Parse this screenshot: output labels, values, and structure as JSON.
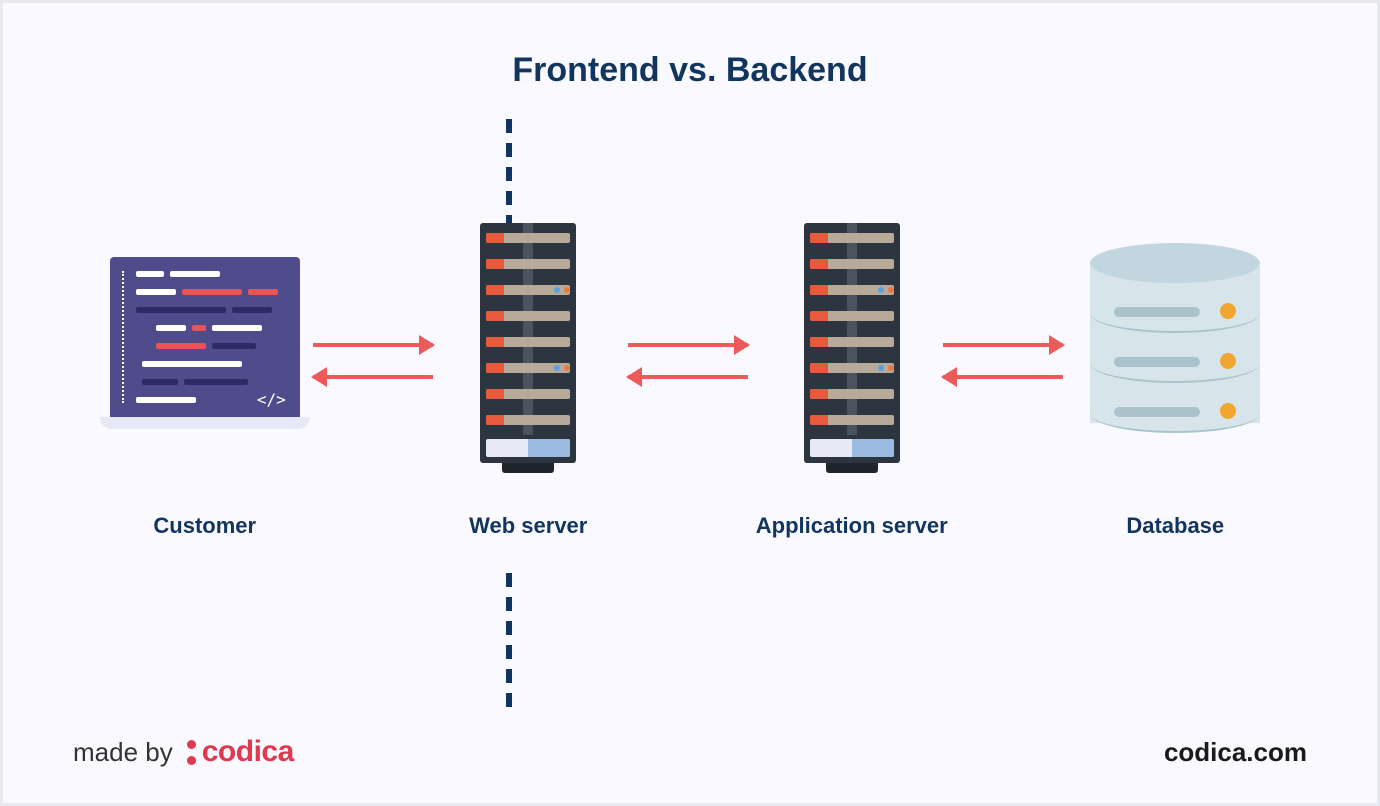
{
  "title": "Frontend vs. Backend",
  "nodes": {
    "customer": "Customer",
    "web_server": "Web server",
    "app_server": "Application server",
    "database": "Database"
  },
  "footer": {
    "made_by": "made by",
    "brand": "codica",
    "url": "codica.com"
  },
  "colors": {
    "title": "#12355f",
    "arrow": "#ec5a5a",
    "brand": "#e2384d",
    "laptop_bg": "#4e4c8a",
    "server_bg": "#2d3640",
    "db_fill": "#d7e5eb",
    "db_accent": "#f0a630"
  }
}
